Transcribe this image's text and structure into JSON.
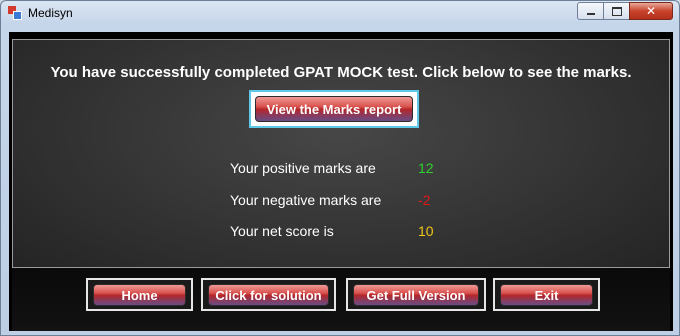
{
  "window": {
    "title": "Medisyn",
    "minimize_icon": "minimize-icon",
    "maximize_icon": "maximize-icon",
    "close_label": "✕"
  },
  "main": {
    "headline": "You have successfully completed GPAT MOCK test. Click below to see the marks.",
    "report_button": "View the Marks report",
    "stats": [
      {
        "label": "Your positive marks are",
        "value": "12",
        "color": "#2fd12f"
      },
      {
        "label": "Your negative marks are",
        "value": "-2",
        "color": "#e01818"
      },
      {
        "label": "Your net score  is",
        "value": "10",
        "color": "#f0c419"
      }
    ]
  },
  "footer": {
    "buttons": [
      {
        "label": "Home"
      },
      {
        "label": "Click for solution"
      },
      {
        "label": "Get Full Version"
      },
      {
        "label": "Exit"
      }
    ]
  },
  "colors": {
    "accent_button": "#d9534f",
    "report_border": "#5ec8e8"
  }
}
